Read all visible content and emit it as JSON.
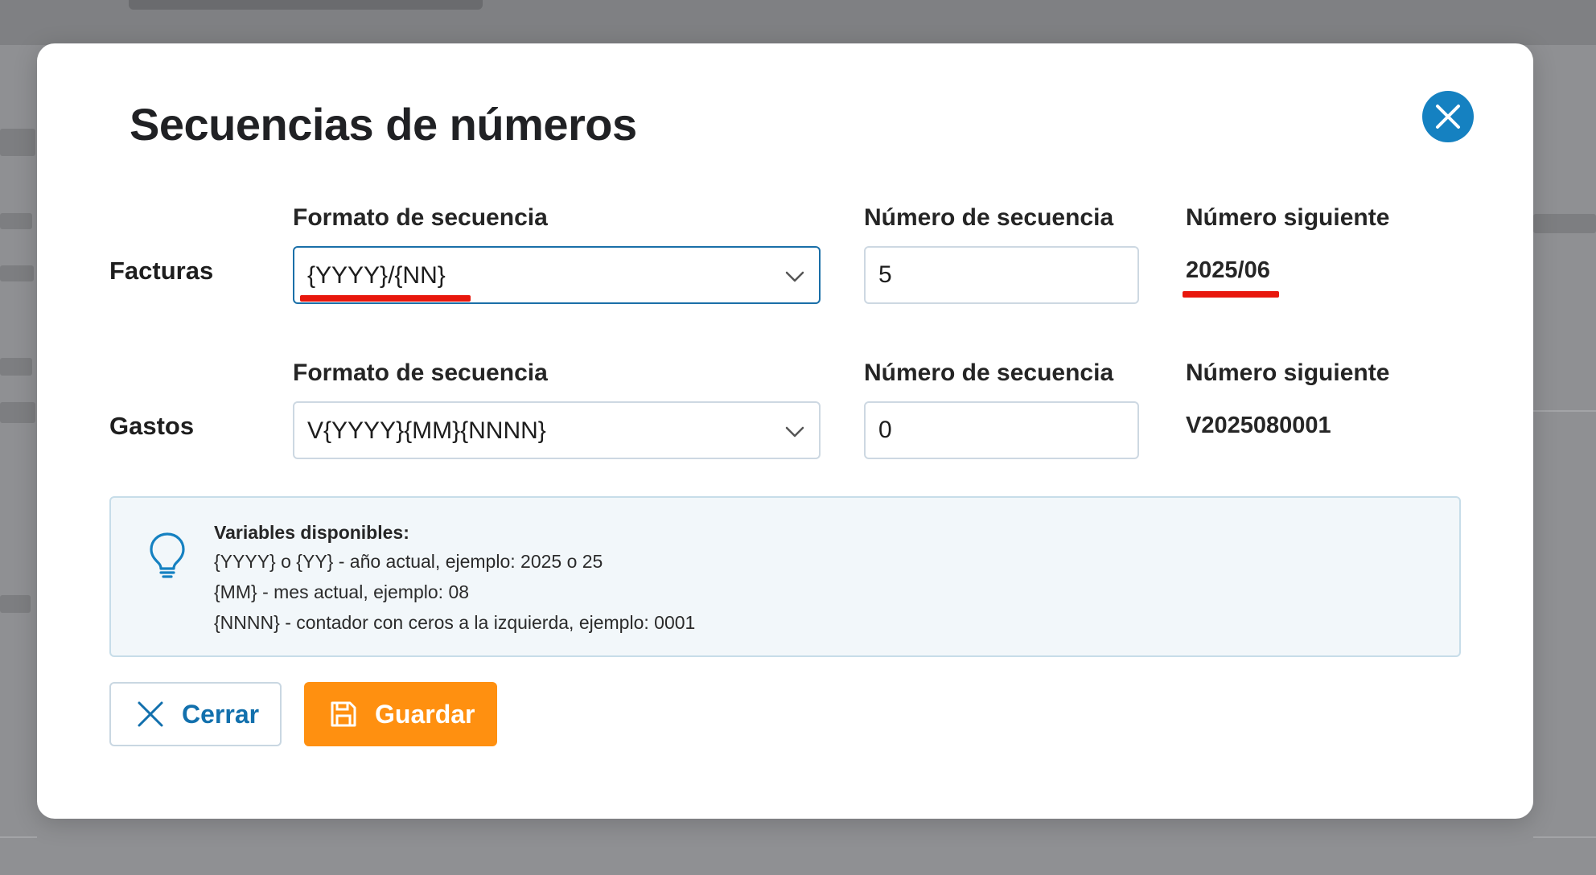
{
  "modal": {
    "title": "Secuencias de números",
    "close_icon": "close-circle-icon"
  },
  "rows": [
    {
      "label": "Facturas",
      "format_label": "Formato de secuencia",
      "format_value": "{YYYY}/{NN}",
      "sequence_label": "Número de secuencia",
      "sequence_value": "5",
      "next_label": "Número siguiente",
      "next_value": "2025/06"
    },
    {
      "label": "Gastos",
      "format_label": "Formato de secuencia",
      "format_value": "V{YYYY}{MM}{NNNN}",
      "sequence_label": "Número de secuencia",
      "sequence_value": "0",
      "next_label": "Número siguiente",
      "next_value": "V2025080001"
    }
  ],
  "info": {
    "icon": "lightbulb-icon",
    "title": "Variables disponibles:",
    "lines": [
      "{YYYY} o {YY} - año actual, ejemplo: 2025 o 25",
      "{MM} - mes actual, ejemplo: 08",
      "{NNNN} - contador con ceros a la izquierda, ejemplo: 0001"
    ]
  },
  "buttons": {
    "close_label": "Cerrar",
    "close_icon": "x-icon",
    "save_label": "Guardar",
    "save_icon": "save-icon"
  },
  "colors": {
    "accent_blue": "#1581c1",
    "save_orange": "#ff9010",
    "annotation_red": "#e8170c",
    "info_bg": "#f2f7fa"
  }
}
